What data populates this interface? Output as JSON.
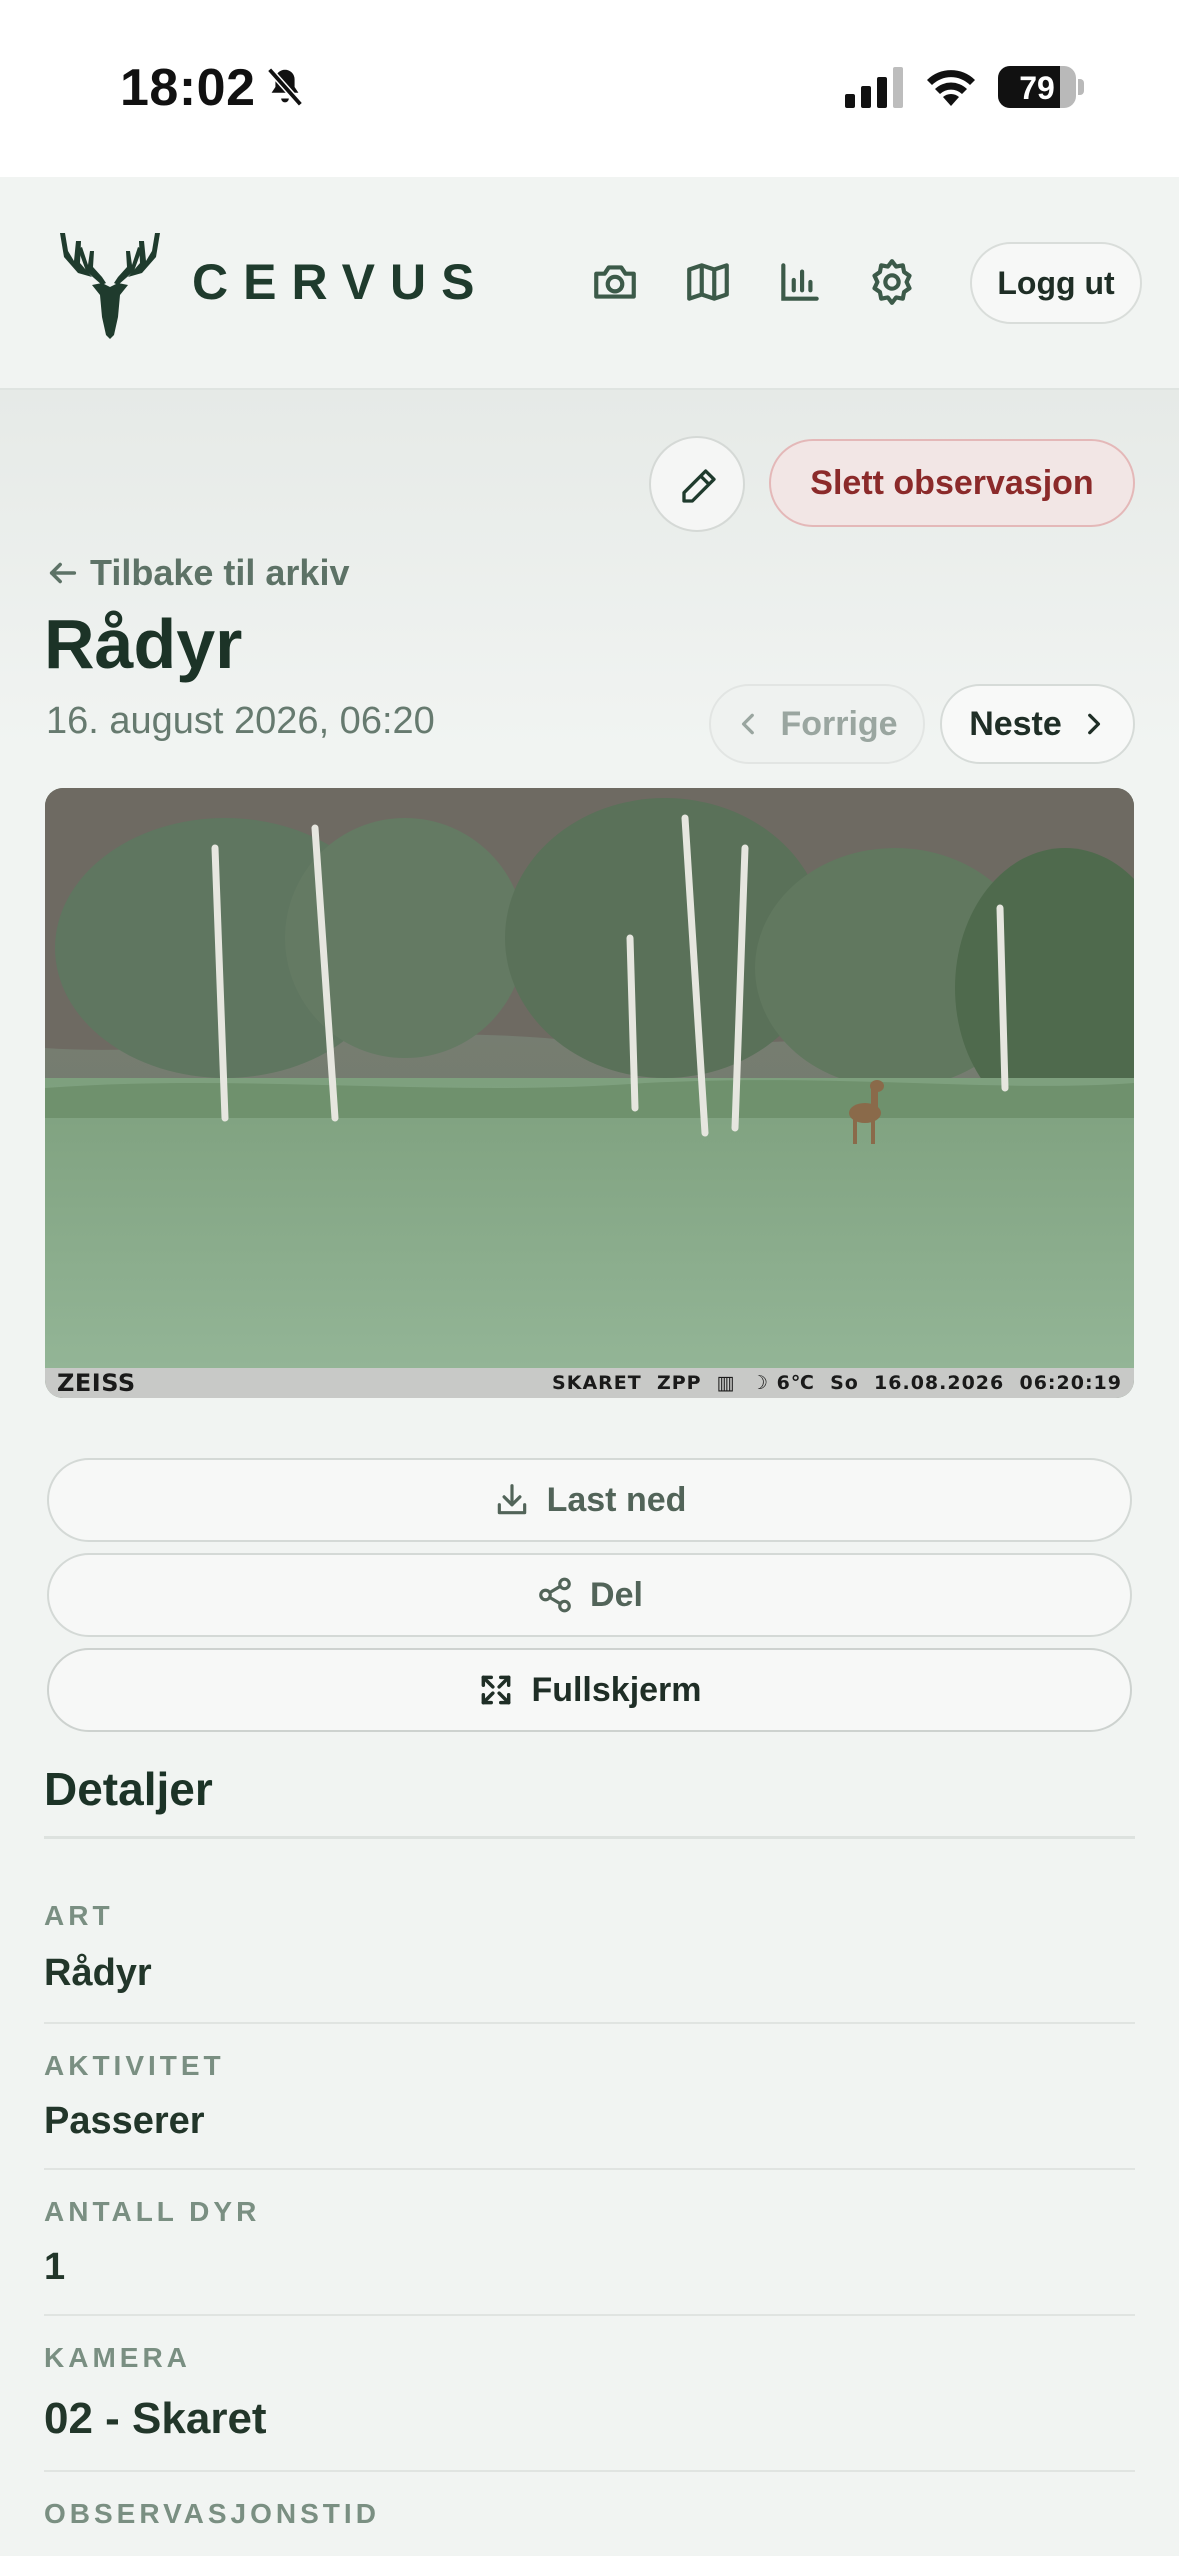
{
  "status_bar": {
    "time": "18:02",
    "battery_level": 79,
    "battery_label": "79",
    "icons": [
      "bell-slash-icon",
      "cellular-signal-icon",
      "wifi-icon",
      "battery-icon"
    ]
  },
  "header": {
    "brand": "CERVUS",
    "nav_icons": [
      "camera-icon",
      "map-icon",
      "chart-icon",
      "gear-icon"
    ],
    "logout_label": "Logg ut"
  },
  "toolbar": {
    "edit_icon": "pencil-icon",
    "delete_label": "Slett observasjon"
  },
  "observation": {
    "back_label": "Tilbake til arkiv",
    "title": "Rådyr",
    "datetime": "16. august 2026, 06:20",
    "prev_label": "Forrige",
    "next_label": "Neste",
    "prev_enabled": false
  },
  "photo": {
    "brand": "ZEISS",
    "stamp": "SKARET  ZPP  ▥  ☽ 6℃  So  16.08.2026  06:20:19"
  },
  "actions": {
    "download_label": "Last ned",
    "share_label": "Del",
    "fullscreen_label": "Fullskjerm"
  },
  "details": {
    "title": "Detaljer",
    "rows": [
      {
        "label": "ART",
        "value": "Rådyr"
      },
      {
        "label": "AKTIVITET",
        "value": "Passerer"
      },
      {
        "label": "ANTALL DYR",
        "value": "1"
      },
      {
        "label": "KAMERA",
        "value": "02 - Skaret"
      },
      {
        "label": "OBSERVASJONSTID",
        "value": ""
      }
    ]
  },
  "colors": {
    "brand_green": "#1f3b2d",
    "danger": "#8b2a2a",
    "danger_bg": "#f2e6e5",
    "muted": "#7a8f82"
  }
}
